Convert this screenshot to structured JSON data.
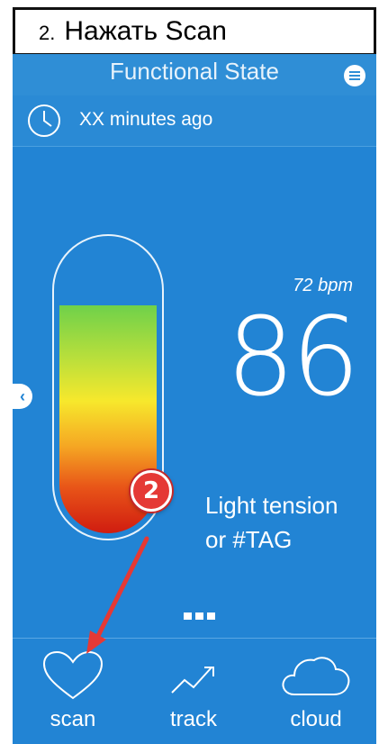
{
  "instruction": {
    "number": "2.",
    "text": "Нажать Scan"
  },
  "header": {
    "title": "Functional State",
    "menu_icon": "menu-icon"
  },
  "time": {
    "text": "XX minutes ago",
    "icon": "clock-icon"
  },
  "reading": {
    "bpm": "72 bpm",
    "value": "86",
    "status_line1": "Light tension",
    "status_line2": "or #TAG",
    "gauge_fill_fraction": 0.78
  },
  "annotation": {
    "badge": "2",
    "color": "#e53935"
  },
  "nav": [
    {
      "label": "scan",
      "icon": "heart-icon"
    },
    {
      "label": "track",
      "icon": "trend-icon"
    },
    {
      "label": "cloud",
      "icon": "cloud-icon"
    }
  ],
  "colors": {
    "background": "#2284d4",
    "accent": "#ffffff"
  }
}
